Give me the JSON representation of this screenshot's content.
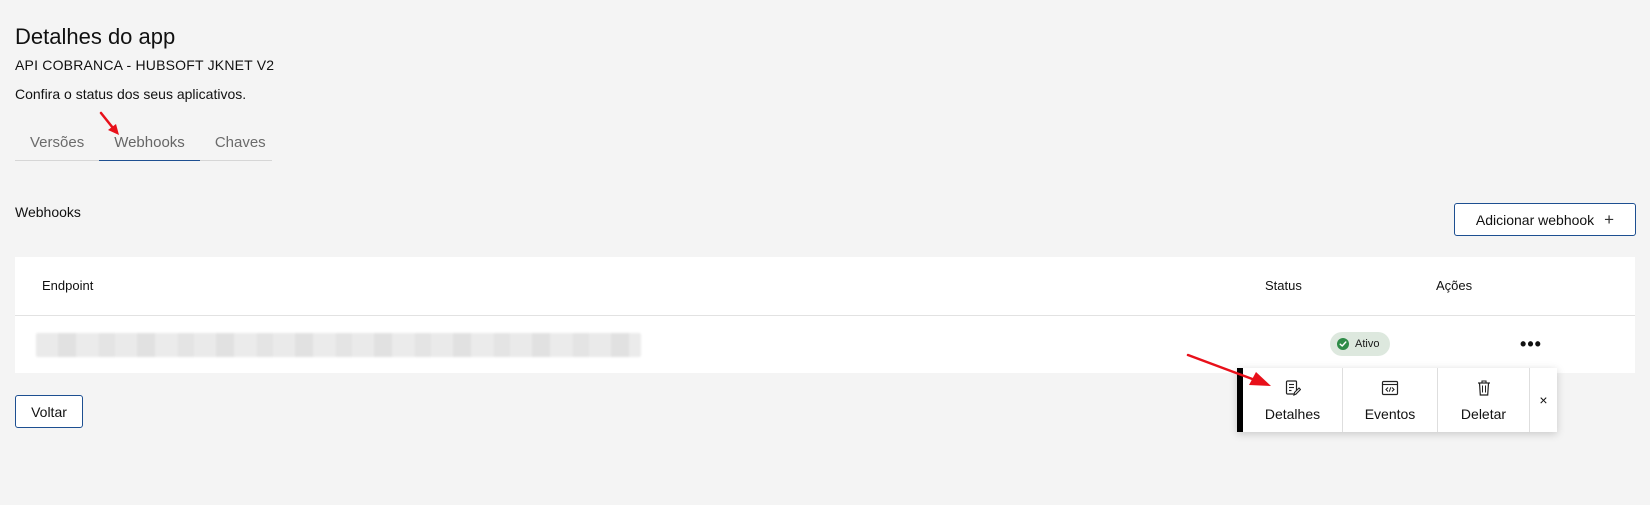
{
  "header": {
    "title": "Detalhes do app",
    "app_name": "API COBRANCA - HUBSOFT JKNET V2",
    "subtitle": "Confira o status dos seus aplicativos."
  },
  "tabs": [
    {
      "label": "Versões",
      "active": false
    },
    {
      "label": "Webhooks",
      "active": true
    },
    {
      "label": "Chaves",
      "active": false
    }
  ],
  "webhooks": {
    "section_title": "Webhooks",
    "add_button_label": "Adicionar webhook",
    "add_button_icon": "+",
    "table": {
      "columns": [
        "Endpoint",
        "Status",
        "Ações"
      ],
      "rows": [
        {
          "endpoint": "",
          "status": "Ativo",
          "actions_icon": "•••"
        }
      ]
    }
  },
  "back_button_label": "Voltar",
  "actions_menu": {
    "items": [
      {
        "label": "Detalhes",
        "icon": "edit-document-icon"
      },
      {
        "label": "Eventos",
        "icon": "code-window-icon"
      },
      {
        "label": "Deletar",
        "icon": "trash-icon"
      }
    ],
    "close_label": "×"
  },
  "colors": {
    "accent": "#1d4f91",
    "status_active_bg": "#dde8de",
    "status_active_dot": "#2e8b47",
    "annotation_arrow": "#e8101a",
    "page_bg": "#f4f4f4"
  }
}
